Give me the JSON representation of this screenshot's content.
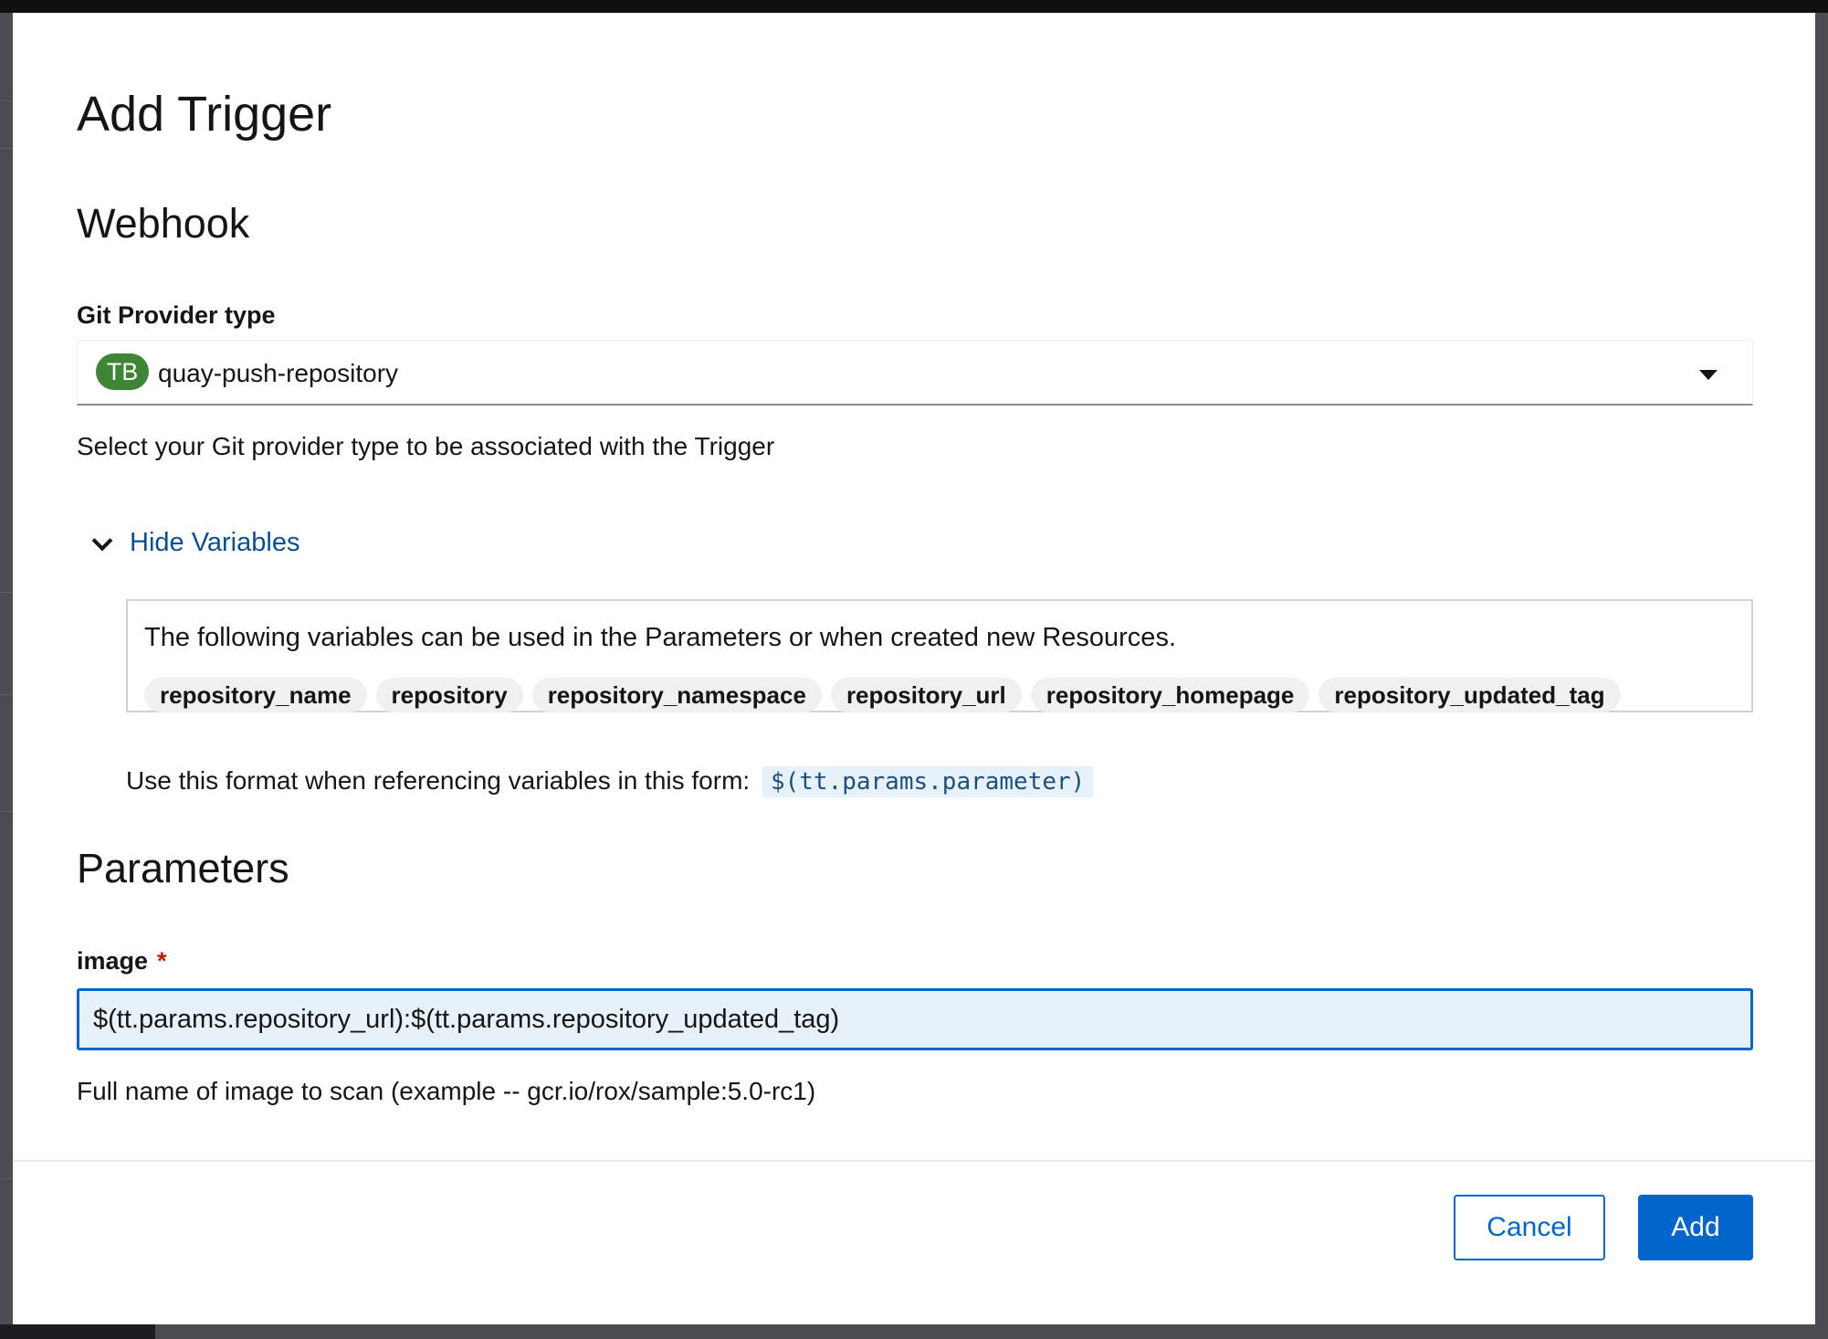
{
  "modal": {
    "title": "Add Trigger",
    "webhook_heading": "Webhook",
    "git_provider": {
      "label": "Git Provider type",
      "avatar_text": "TB",
      "selected_value": "quay-push-repository",
      "helper": "Select your Git provider type to be associated with the Trigger"
    },
    "variables": {
      "toggle_label": "Hide Variables",
      "description": "The following variables can be used in the Parameters or when created new Resources.",
      "chips": [
        "repository_name",
        "repository",
        "repository_namespace",
        "repository_url",
        "repository_homepage",
        "repository_updated_tag"
      ],
      "format_hint": "Use this format when referencing variables in this form:",
      "format_code": "$(tt.params.parameter)"
    },
    "parameters_heading": "Parameters",
    "image_field": {
      "label": "image",
      "required_marker": "*",
      "value": "$(tt.params.repository_url):$(tt.params.repository_updated_tag)",
      "helper": "Full name of image to scan (example -- gcr.io/rox/sample:5.0-rc1)"
    },
    "footer": {
      "cancel_label": "Cancel",
      "add_label": "Add"
    }
  },
  "colors": {
    "primary": "#0066cc",
    "avatar": "#3e8635",
    "required": "#c9190b",
    "input_focus_bg": "#e7f1fa"
  }
}
